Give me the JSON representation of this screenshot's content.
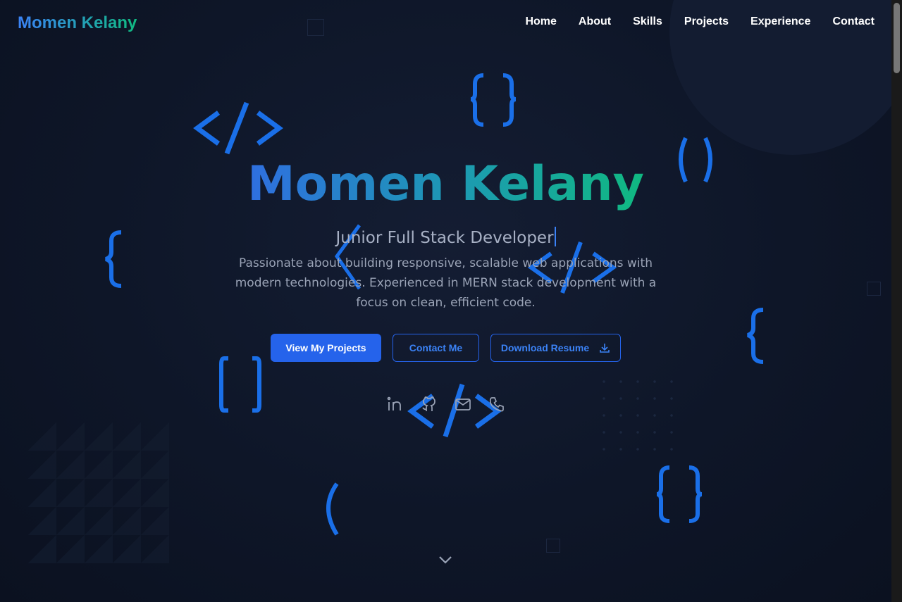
{
  "brand": {
    "name": "Momen Kelany"
  },
  "nav": {
    "items": [
      "Home",
      "About",
      "Skills",
      "Projects",
      "Experience",
      "Contact"
    ]
  },
  "hero": {
    "title": "Momen Kelany",
    "subtitle": "Junior Full Stack Developer",
    "description": "Passionate about building responsive, scalable web applications with modern technologies. Experienced in MERN stack development with a focus on clean, efficient code.",
    "buttons": {
      "projects": "View My Projects",
      "contact": "Contact Me",
      "resume": "Download Resume"
    },
    "socials": [
      "linkedin-icon",
      "github-icon",
      "mail-icon",
      "phone-icon"
    ]
  },
  "colors": {
    "accent": "#2563eb",
    "gradient_start": "#3b82f6",
    "gradient_end": "#10b981",
    "background": "#0d1424",
    "glyph": "#1a6fe8"
  }
}
